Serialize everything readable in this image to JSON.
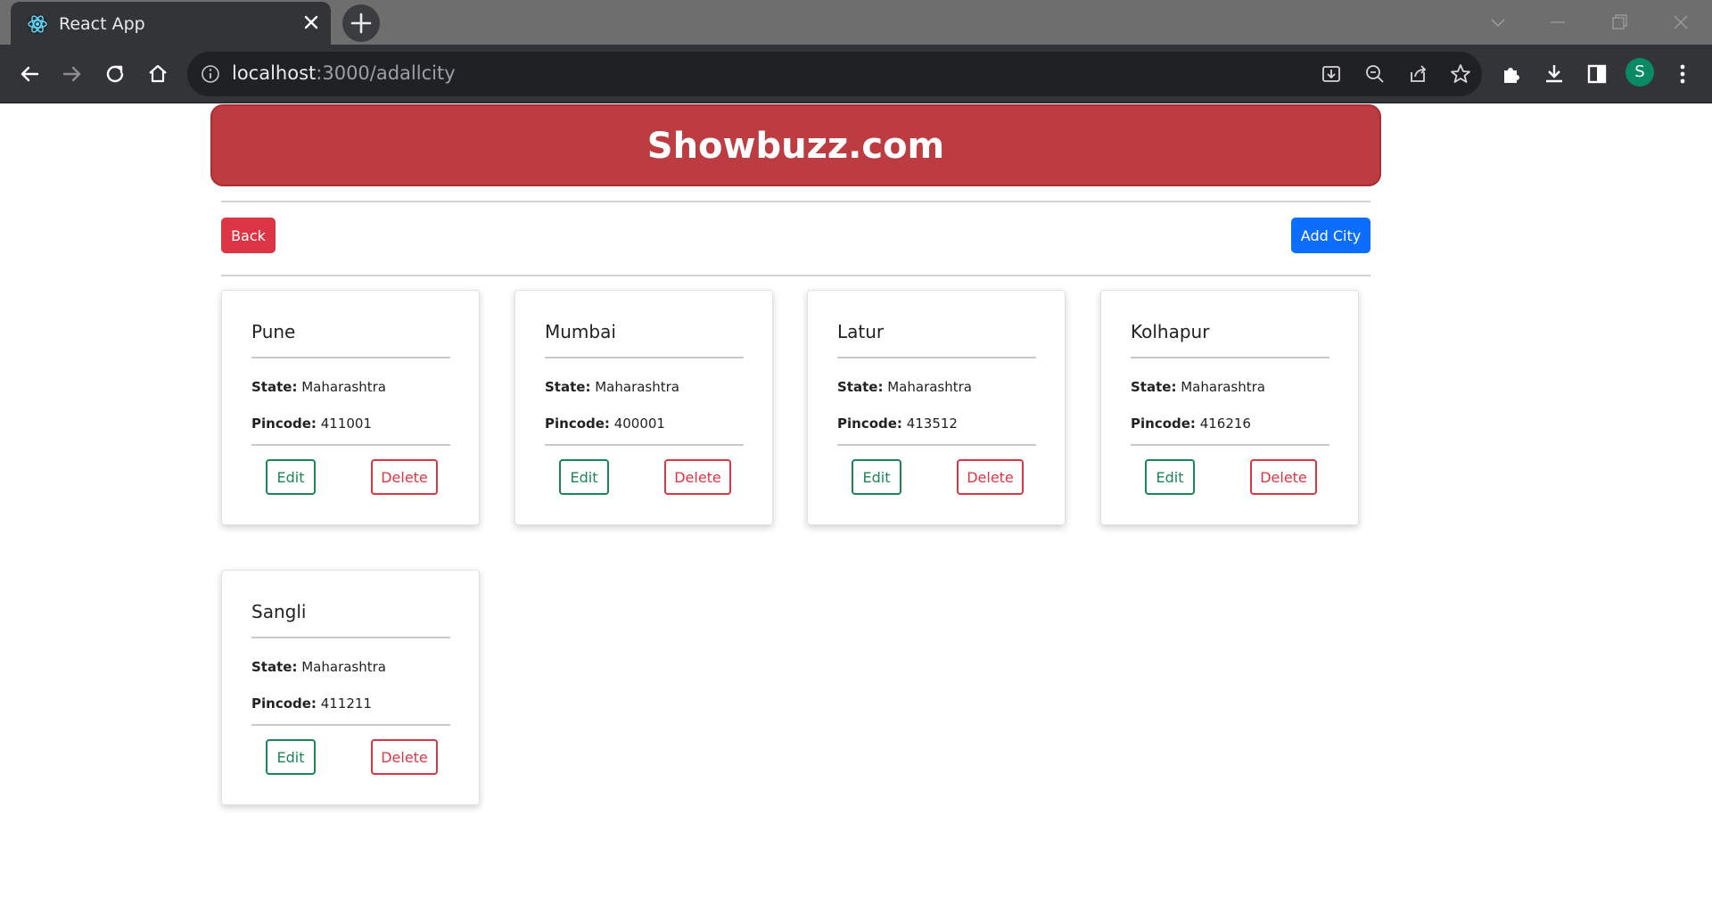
{
  "browser": {
    "tab_title": "React App",
    "url_host": "localhost",
    "url_path": ":3000/adallcity",
    "profile_initial": "S"
  },
  "app": {
    "title": "Showbuzz.com",
    "back_label": "Back",
    "add_label": "Add City"
  },
  "labels": {
    "state": "State:",
    "pincode": "Pincode:",
    "edit": "Edit",
    "delete": "Delete"
  },
  "cities": [
    {
      "name": "Pune",
      "state": "Maharashtra",
      "pincode": "411001"
    },
    {
      "name": "Mumbai",
      "state": "Maharashtra",
      "pincode": "400001"
    },
    {
      "name": "Latur",
      "state": "Maharashtra",
      "pincode": "413512"
    },
    {
      "name": "Kolhapur",
      "state": "Maharashtra",
      "pincode": "416216"
    },
    {
      "name": "Sangli",
      "state": "Maharashtra",
      "pincode": "411211"
    }
  ],
  "colors": {
    "banner": "#bd3c42",
    "back_button": "#dc3545",
    "add_button": "#0d6efd",
    "edit_outline": "#198754",
    "delete_outline": "#dc3545"
  }
}
